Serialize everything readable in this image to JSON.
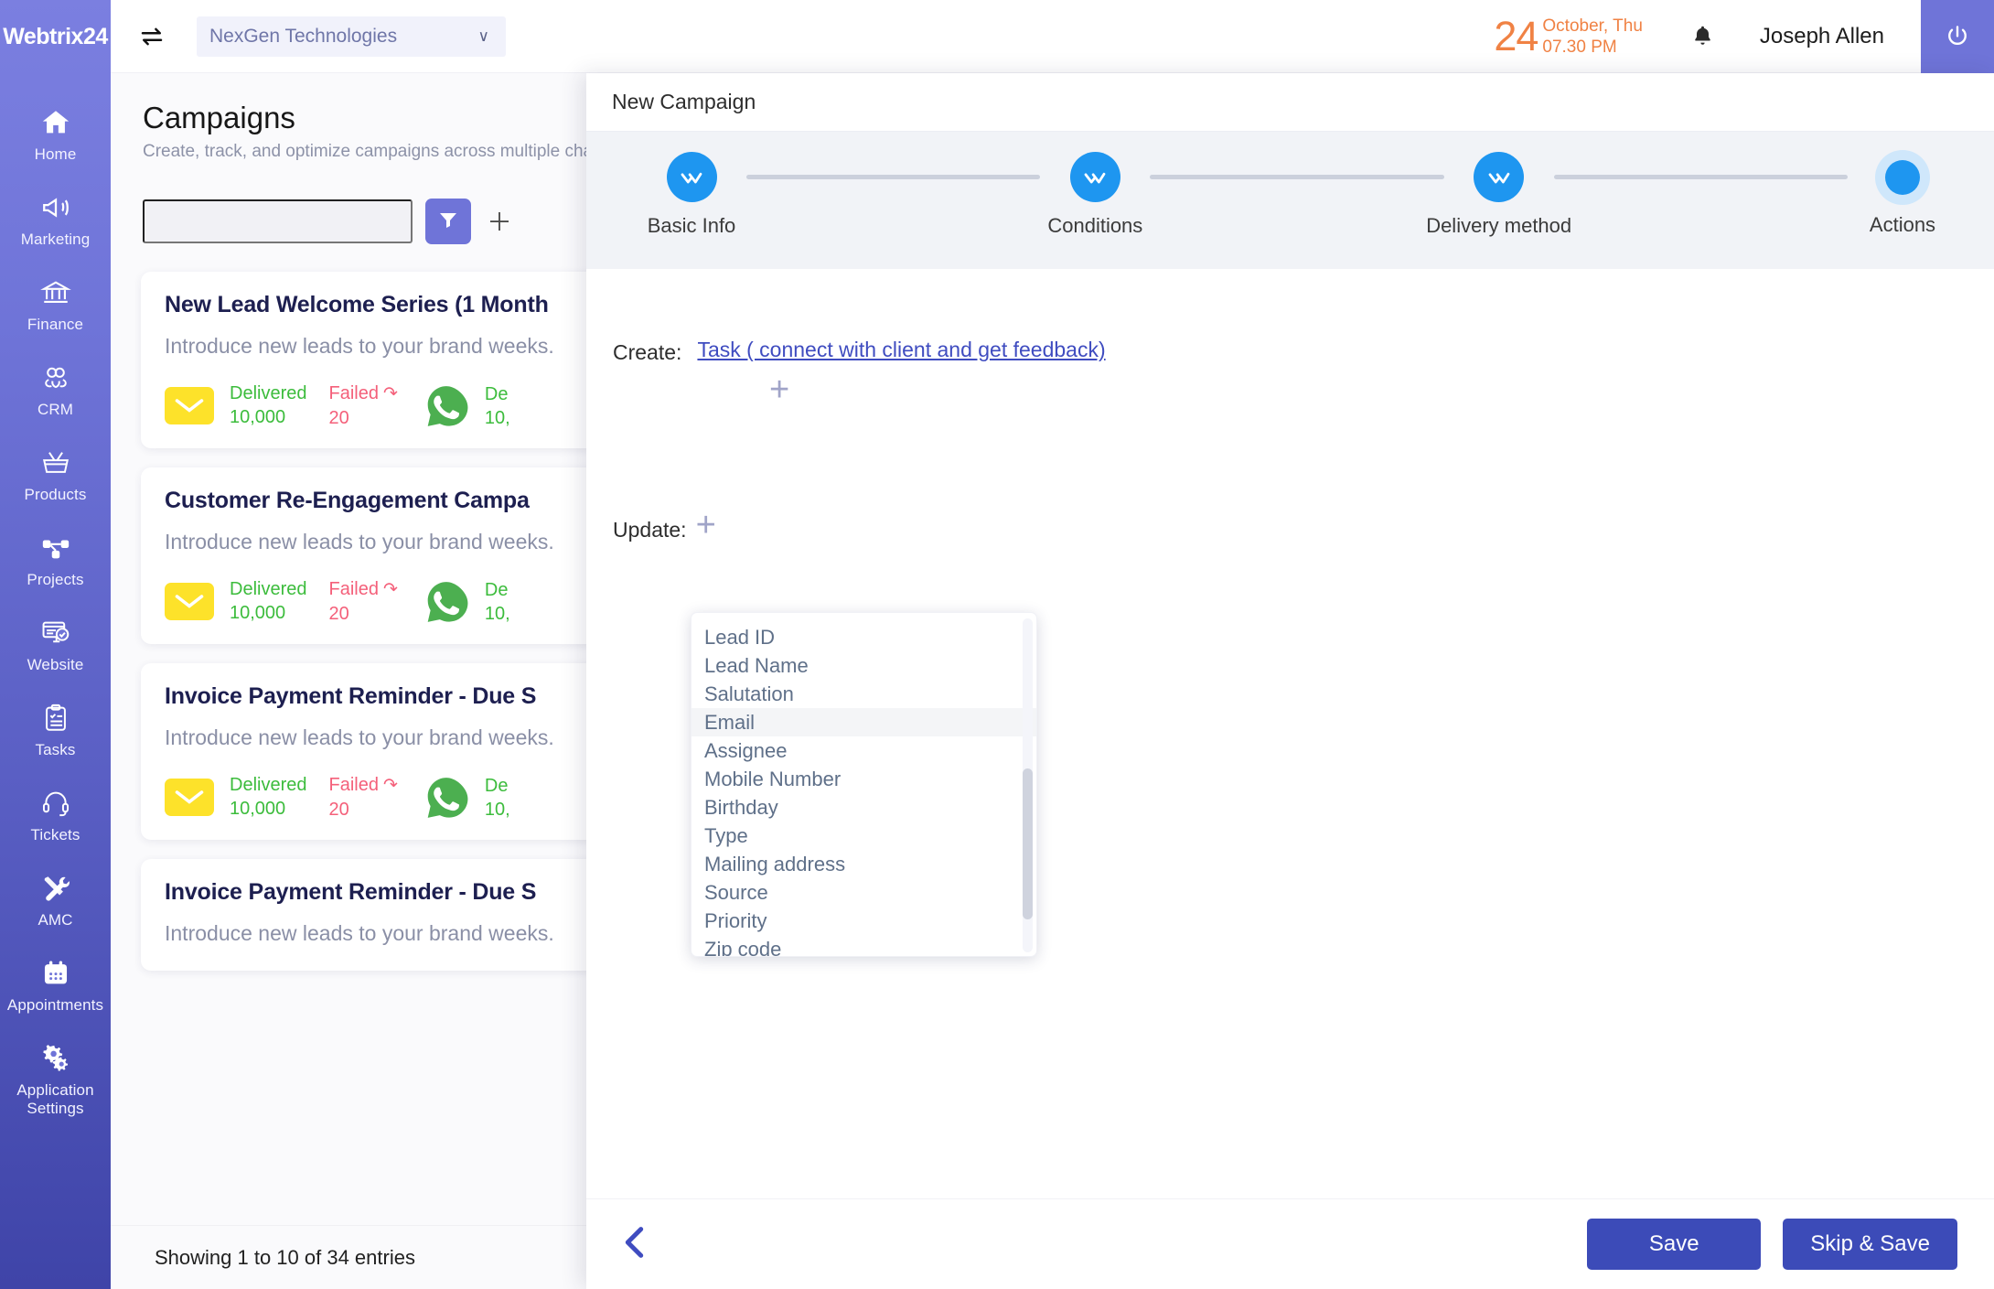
{
  "sidebar": {
    "logo": "Webtrix24",
    "items": [
      {
        "label": "Home",
        "icon": "home-icon"
      },
      {
        "label": "Marketing",
        "icon": "megaphone-icon"
      },
      {
        "label": "Finance",
        "icon": "bank-icon"
      },
      {
        "label": "CRM",
        "icon": "people-icon"
      },
      {
        "label": "Products",
        "icon": "basket-icon"
      },
      {
        "label": "Projects",
        "icon": "nodes-icon"
      },
      {
        "label": "Website",
        "icon": "monitor-check-icon"
      },
      {
        "label": "Tasks",
        "icon": "clipboard-icon"
      },
      {
        "label": "Tickets",
        "icon": "headset-icon"
      },
      {
        "label": "AMC",
        "icon": "tools-icon"
      },
      {
        "label": "Appointments",
        "icon": "calendar-icon"
      },
      {
        "label": "Application Settings",
        "icon": "gears-icon"
      }
    ]
  },
  "topbar": {
    "switch_icon": "switch-arrows-icon",
    "organization": "NexGen Technologies",
    "caret": "∨",
    "date_number": "24",
    "date_month_day": "October, Thu",
    "time": "07.30 PM",
    "bell_icon": "bell-icon",
    "user_name": "Joseph Allen",
    "power_icon": "power-icon"
  },
  "page": {
    "title": "Campaigns",
    "subtitle": "Create, track, and optimize campaigns across multiple chan",
    "search_placeholder": "",
    "filter_icon": "funnel-icon",
    "add_icon": "plus-icon",
    "entries_text": "Showing 1 to 10 of 34 entries",
    "cards": [
      {
        "title": "New Lead Welcome Series (1 Month",
        "description": "Introduce new leads to your brand  weeks.",
        "email": {
          "delivered_label": "Delivered",
          "delivered": "10,000",
          "failed_label": "Failed",
          "failed": "20"
        },
        "whatsapp": {
          "delivered_label": "De",
          "delivered": "10,"
        }
      },
      {
        "title": "Customer Re-Engagement Campa",
        "description": "Introduce new leads to your brand  weeks.",
        "email": {
          "delivered_label": "Delivered",
          "delivered": "10,000",
          "failed_label": "Failed",
          "failed": "20"
        },
        "whatsapp": {
          "delivered_label": "De",
          "delivered": "10,"
        }
      },
      {
        "title": "Invoice Payment Reminder - Due S",
        "description": "Introduce new leads to your brand  weeks.",
        "email": {
          "delivered_label": "Delivered",
          "delivered": "10,000",
          "failed_label": "Failed",
          "failed": "20"
        },
        "whatsapp": {
          "delivered_label": "De",
          "delivered": "10,"
        }
      },
      {
        "title": "Invoice Payment Reminder - Due S",
        "description": "Introduce new leads to your brand  weeks.",
        "email": {
          "delivered_label": "",
          "delivered": "",
          "failed_label": "",
          "failed": ""
        },
        "whatsapp": {
          "delivered_label": "",
          "delivered": ""
        }
      }
    ]
  },
  "modal": {
    "title": "New Campaign",
    "steps": [
      {
        "label": "Basic Info",
        "state": "completed"
      },
      {
        "label": "Conditions",
        "state": "completed"
      },
      {
        "label": "Delivery method",
        "state": "completed"
      },
      {
        "label": "Actions",
        "state": "active"
      }
    ],
    "create": {
      "label": "Create:",
      "link": "Task ( connect with client and get feedback)",
      "add_icon": "plus-icon"
    },
    "update": {
      "label": "Update:",
      "add_icon": "plus-icon",
      "dropdown_options": [
        "Lead ID",
        "Lead Name",
        "Salutation",
        "Email",
        "Assignee",
        "Mobile Number",
        "Birthday",
        "Type",
        "Mailing address",
        "Source",
        "Priority",
        "Zip code"
      ],
      "selected_option": "Email"
    },
    "footer": {
      "back_icon": "chevron-left-icon",
      "save_label": "Save",
      "skip_save_label": "Skip & Save"
    }
  },
  "colors": {
    "sidebar_top": "#7b7fe0",
    "sidebar_bottom": "#3f44a8",
    "accent_purple": "#6f74d8",
    "button_blue": "#3c4bb8",
    "step_blue": "#1e96f0",
    "date_orange": "#f08244",
    "delivered_green": "#3cbc3c",
    "failed_red": "#f4607a",
    "mail_yellow": "#fde22a",
    "whatsapp_green": "#4caf50"
  }
}
